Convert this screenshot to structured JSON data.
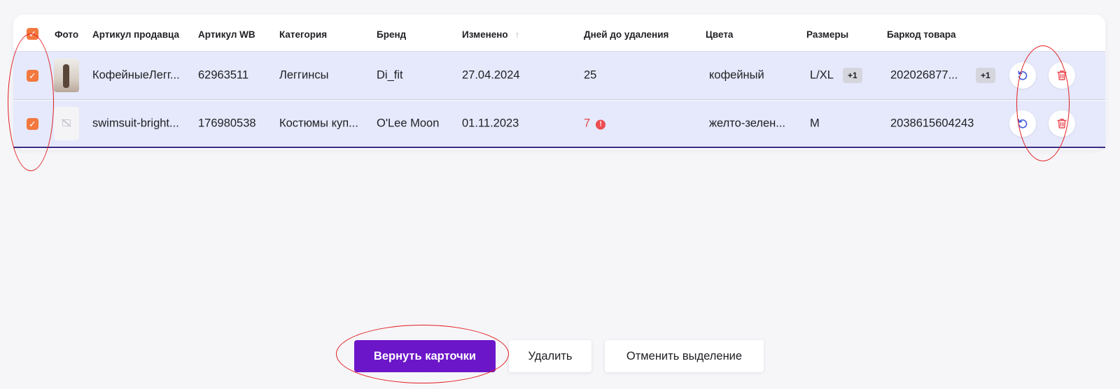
{
  "table": {
    "columns": {
      "photo": "Фото",
      "seller_article": "Артикул продавца",
      "wb_article": "Артикул WB",
      "category": "Категория",
      "brand": "Бренд",
      "changed": "Изменено",
      "days_to_delete": "Дней до удаления",
      "colors": "Цвета",
      "sizes": "Размеры",
      "barcode": "Баркод товара"
    },
    "sort_icon": "arrow-up-icon",
    "rows": [
      {
        "checked": true,
        "seller_article": "КофейныеЛегг...",
        "wb_article": "62963511",
        "category": "Леггинсы",
        "brand": "Di_fit",
        "changed": "27.04.2024",
        "days_to_delete": "25",
        "days_warning": false,
        "color": "кофейный",
        "size": "L/XL",
        "size_more": "+1",
        "barcode": "202026877...",
        "barcode_more": "+1"
      },
      {
        "checked": true,
        "seller_article": "swimsuit-bright...",
        "wb_article": "176980538",
        "category": "Костюмы куп...",
        "brand": "O'Lee Moon",
        "changed": "01.11.2023",
        "days_to_delete": "7",
        "days_warning": true,
        "warning_glyph": "!",
        "color": "желто-зелен...",
        "size": "M",
        "barcode": "2038615604243"
      }
    ]
  },
  "actions": {
    "restore_label": "Вернуть карточки",
    "delete_label": "Удалить",
    "deselect_label": "Отменить выделение"
  },
  "colors": {
    "accent": "#6c16c9",
    "checkbox": "#f2783f",
    "row_selected": "#e5e9fb",
    "warning": "#e4464a",
    "annotation": "#e21d1d"
  }
}
